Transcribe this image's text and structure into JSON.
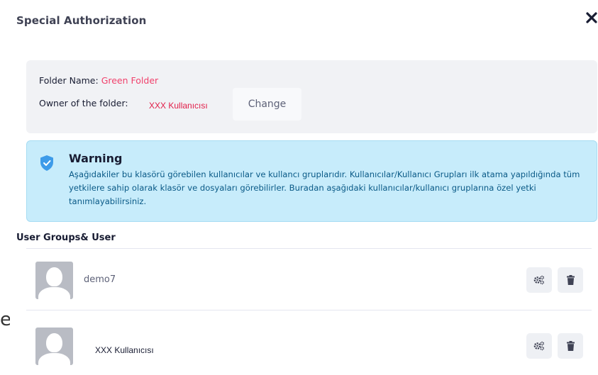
{
  "modal": {
    "title": "Special Authorization",
    "close_glyph": "✕"
  },
  "folder": {
    "name_label": "Folder Name:",
    "name_value": "Green Folder",
    "owner_label": "Owner of the folder:",
    "owner_value": "XXX Kullanıcısı",
    "change_label": "Change"
  },
  "warning": {
    "icon": "shield-check-icon",
    "title": "Warning",
    "text": "Aşağıdakiler bu klasörü görebilen kullanıcılar ve kullancı gruplarıdır. Kullanıcılar/Kullanıcı Grupları ilk atama yapıldığında tüm yetkilere sahip olarak klasör ve dosyaları görebilirler. Buradan aşağıdaki kullanıcılar/kullanıcı gruplarına özel yetki tanımlayabilirsiniz."
  },
  "users_section": {
    "title": "User Groups& User",
    "users": [
      {
        "name": "demo7",
        "avatar": "user-avatar-placeholder",
        "actions": [
          "gears-icon",
          "trash-icon"
        ]
      },
      {
        "name": "XXX Kullanıcısı",
        "avatar": "user-avatar-placeholder",
        "actions": [
          "gears-icon",
          "trash-icon"
        ]
      }
    ]
  },
  "background": {
    "partial_letter": "e"
  },
  "colors": {
    "accent_red": "#f1416c",
    "warning_bg": "#c7ecfb",
    "warning_text": "#0a5a87",
    "shield_blue": "#3d9be9"
  }
}
